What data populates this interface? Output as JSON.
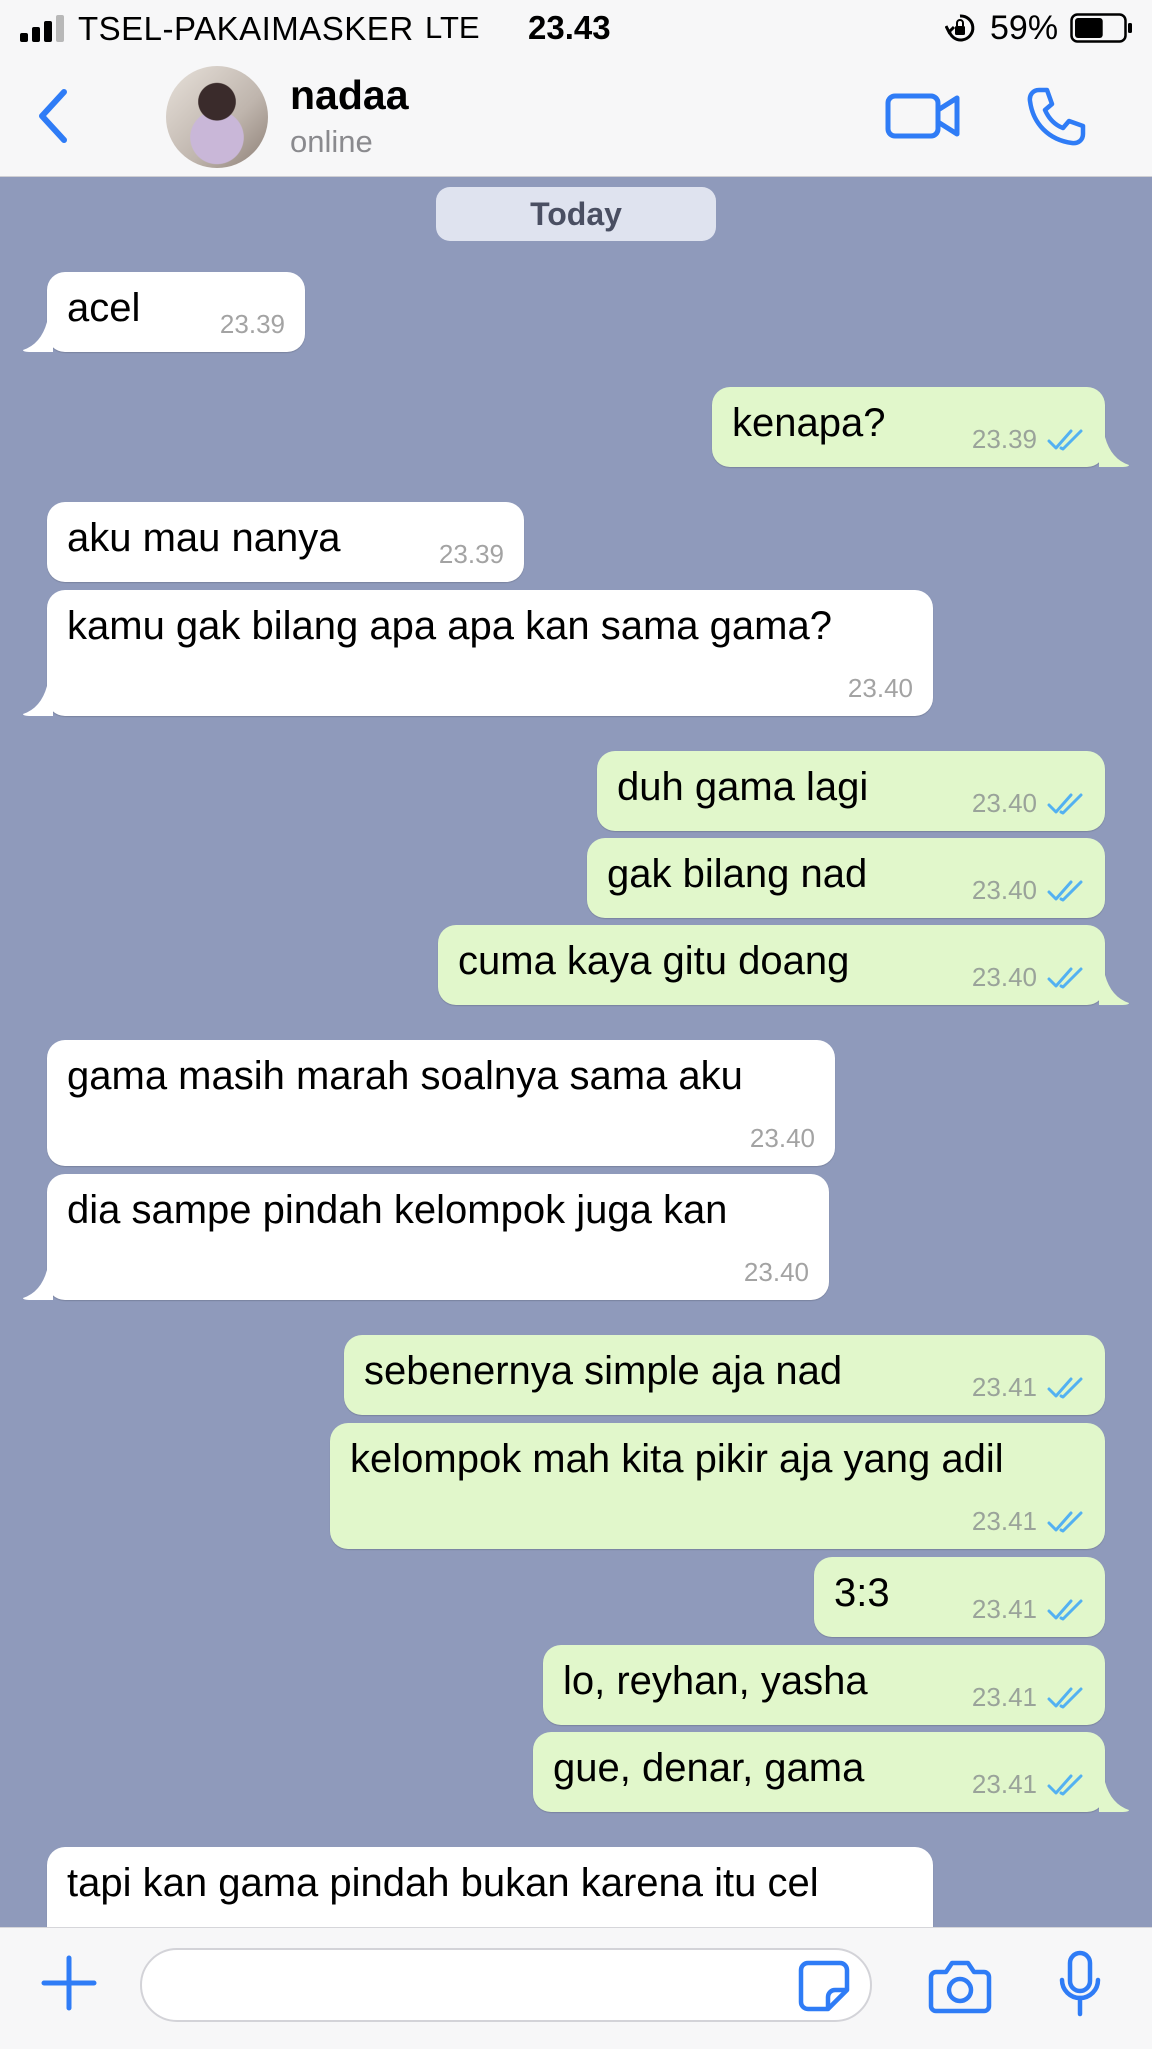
{
  "status_bar": {
    "carrier": "TSEL-PAKAIMASKER",
    "network": "LTE",
    "time": "23.43",
    "battery": "59%",
    "battery_level": 0.59
  },
  "header": {
    "back_icon": "chevron-left-icon",
    "contact_name": "nadaa",
    "contact_status": "online",
    "video_icon": "video-camera-icon",
    "call_icon": "phone-icon"
  },
  "chat": {
    "date_label": "Today",
    "messages": [
      {
        "dir": "in",
        "text": "acel",
        "time": "23.39"
      },
      {
        "dir": "out",
        "text": "kenapa?",
        "time": "23.39"
      },
      {
        "dir": "in",
        "text": "aku mau nanya",
        "time": "23.39"
      },
      {
        "dir": "in",
        "text": "kamu gak bilang apa apa kan sama gama?",
        "time": "23.40"
      },
      {
        "dir": "out",
        "text": "duh gama lagi",
        "time": "23.40"
      },
      {
        "dir": "out",
        "text": "gak bilang nad",
        "time": "23.40"
      },
      {
        "dir": "out",
        "text": "cuma kaya gitu doang",
        "time": "23.40"
      },
      {
        "dir": "in",
        "text": "gama masih marah soalnya sama aku",
        "time": "23.40"
      },
      {
        "dir": "in",
        "text": "dia sampe pindah kelompok juga kan",
        "time": "23.40"
      },
      {
        "dir": "out",
        "text": "sebenernya simple aja nad",
        "time": "23.41"
      },
      {
        "dir": "out",
        "text": "kelompok mah kita pikir aja yang adil",
        "time": "23.41"
      },
      {
        "dir": "out",
        "text": "3:3",
        "time": "23.41"
      },
      {
        "dir": "out",
        "text": "lo, reyhan, yasha",
        "time": "23.41"
      },
      {
        "dir": "out",
        "text": "gue, denar, gama",
        "time": "23.41"
      },
      {
        "dir": "in",
        "text": "tapi kan gama pindah bukan karena itu cel",
        "time": ""
      }
    ]
  },
  "input_bar": {
    "plus_icon": "plus-icon",
    "input_value": "",
    "sticker_icon": "sticker-icon",
    "camera_icon": "camera-icon",
    "mic_icon": "microphone-icon"
  },
  "colors": {
    "accent": "#2f7cf6",
    "chat_background": "#8f9abb",
    "incoming_bubble": "#ffffff",
    "outgoing_bubble": "#e1f7cb",
    "read_ticks": "#53b1f1"
  }
}
